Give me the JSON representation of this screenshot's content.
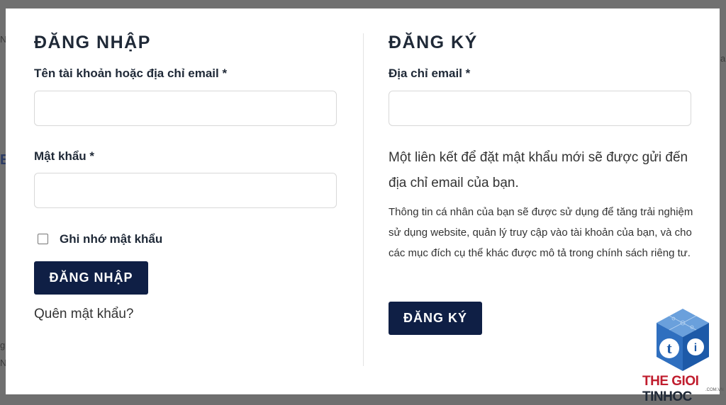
{
  "login": {
    "title": "ĐĂNG NHẬP",
    "username_label": "Tên tài khoản hoặc địa chỉ email *",
    "username_value": "",
    "password_label": "Mật khẩu *",
    "password_value": "",
    "remember_label": "Ghi nhớ mật khẩu",
    "remember_checked": false,
    "submit_label": "ĐĂNG NHẬP",
    "forgot_label": "Quên mật khẩu?"
  },
  "register": {
    "title": "ĐĂNG KÝ",
    "email_label": "Địa chỉ email *",
    "email_value": "",
    "lead_text": "Một liên kết để đặt mật khẩu mới sẽ được gửi đến địa chỉ email của bạn.",
    "privacy_text": "Thông tin cá nhân của bạn sẽ được sử dụng để tăng trải nghiệm sử dụng website, quản lý truy cập vào tài khoản của bạn, và cho các mục đích cụ thể khác được mô tả trong chính sách riêng tư.",
    "submit_label": "ĐĂNG KÝ"
  },
  "logo": {
    "text_red": "THE GIOI ",
    "text_dark": "TINHOC",
    "sub": ".COM.VN",
    "colors": {
      "red": "#c01d2e",
      "blue": "#2f6fbf",
      "navy": "#0f1f45"
    }
  }
}
